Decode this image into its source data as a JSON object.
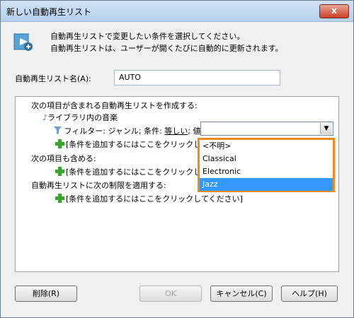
{
  "window": {
    "title": "新しい自動再生リスト",
    "close": "x"
  },
  "intro": {
    "line1": "自動再生リストで変更したい条件を選択してください。",
    "line2": "自動再生リストは、ユーザーが開くたびに自動的に更新されます。"
  },
  "name": {
    "label": "自動再生リスト名(A):",
    "value": "AUTO"
  },
  "rules": {
    "heading1": "次の項目が含まれる自動再生リストを作成する:",
    "library": "ライブラリ内の音楽",
    "filter_prefix": "フィルター: ジャンル; 条件:",
    "filter_op": "等しい",
    "filter_suffix": "; 値:",
    "add_condition": "[条件を追加するにはここをクリックしてください]",
    "heading2": "次の項目も含める:",
    "heading3": "自動再生リストに次の制限を適用する:"
  },
  "combo": {
    "value": "",
    "arrow": "▼"
  },
  "dropdown": {
    "options": [
      "<不明>",
      "Classical",
      "Electronic",
      "Jazz"
    ],
    "selected": "Jazz"
  },
  "buttons": {
    "delete": "削除(R)",
    "ok": "OK",
    "cancel": "キャンセル(C)",
    "help": "ヘルプ(H)"
  },
  "colors": {
    "highlight": "#f08a1c",
    "selection": "#3399ff",
    "accent_green": "#3aa52e"
  }
}
